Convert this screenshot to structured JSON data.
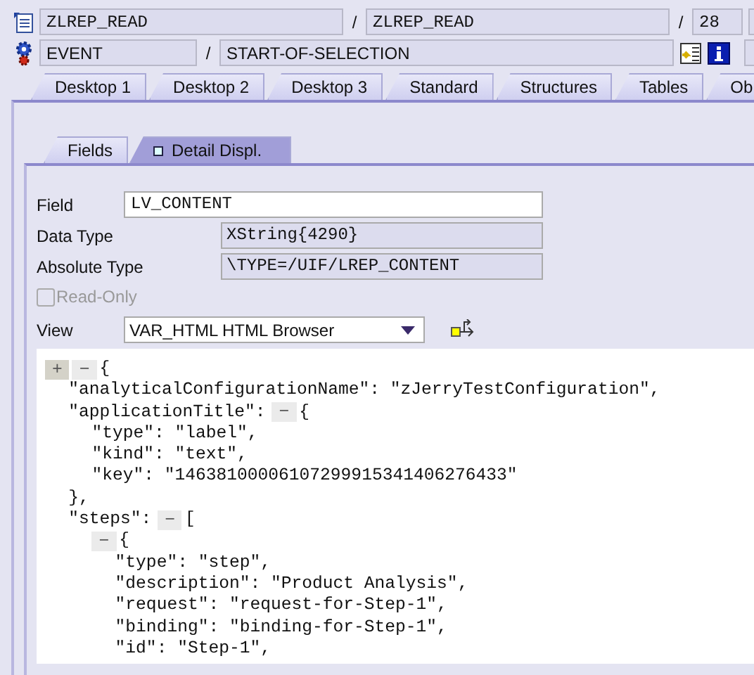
{
  "header": {
    "separators": [
      "/",
      "/",
      "/"
    ],
    "program": "ZLREP_READ",
    "include": "ZLREP_READ",
    "line": "28",
    "event_type": "EVENT",
    "event": "START-OF-SELECTION"
  },
  "tabs": [
    {
      "label": "Desktop 1",
      "selected": false
    },
    {
      "label": "Desktop 2",
      "selected": false
    },
    {
      "label": "Desktop 3",
      "selected": false
    },
    {
      "label": "Standard",
      "selected": false
    },
    {
      "label": "Structures",
      "selected": false
    },
    {
      "label": "Tables",
      "selected": false
    },
    {
      "label": "Ob",
      "selected": false
    }
  ],
  "subtabs": [
    {
      "label": "Fields",
      "selected": false
    },
    {
      "label": "Detail Displ.",
      "selected": true
    }
  ],
  "details": {
    "field_label": "Field",
    "field_value": "LV_CONTENT",
    "data_type_label": "Data Type",
    "data_type": "XString{4290}",
    "absolute_type_label": "Absolute Type",
    "absolute_type": "\\TYPE=/UIF/LREP_CONTENT",
    "read_only": {
      "label": "Read-Only",
      "checked": false,
      "disabled": true
    },
    "view_label": "View",
    "view_value": "VAR_HTML HTML Browser"
  },
  "json_view": [
    {
      "toggles": [
        {
          "label": "+",
          "pressed": true
        },
        {
          "label": "−",
          "pressed": false
        }
      ],
      "text": "{",
      "children": [
        {
          "text": "\"analyticalConfigurationName\": \"zJerryTestConfiguration\","
        },
        {
          "key": "\"applicationTitle\":",
          "toggles": [
            {
              "label": "−",
              "pressed": false
            }
          ],
          "text": "{",
          "children": [
            {
              "text": "\"type\": \"label\","
            },
            {
              "text": "\"kind\": \"text\","
            },
            {
              "text": "\"key\": \"14638100006107299915341406276433\""
            }
          ]
        },
        {
          "text": "},"
        },
        {
          "key": "\"steps\":",
          "toggles": [
            {
              "label": "−",
              "pressed": false
            }
          ],
          "text": "[",
          "children": [
            {
              "toggles": [
                {
                  "label": "−",
                  "pressed": false
                }
              ],
              "text": "{",
              "children": [
                {
                  "text": "\"type\": \"step\","
                },
                {
                  "text": "\"description\": \"Product Analysis\","
                },
                {
                  "text": "\"request\": \"request-for-Step-1\","
                },
                {
                  "text": "\"binding\": \"binding-for-Step-1\","
                },
                {
                  "text": "\"id\": \"Step-1\","
                }
              ]
            }
          ]
        }
      ]
    }
  ]
}
